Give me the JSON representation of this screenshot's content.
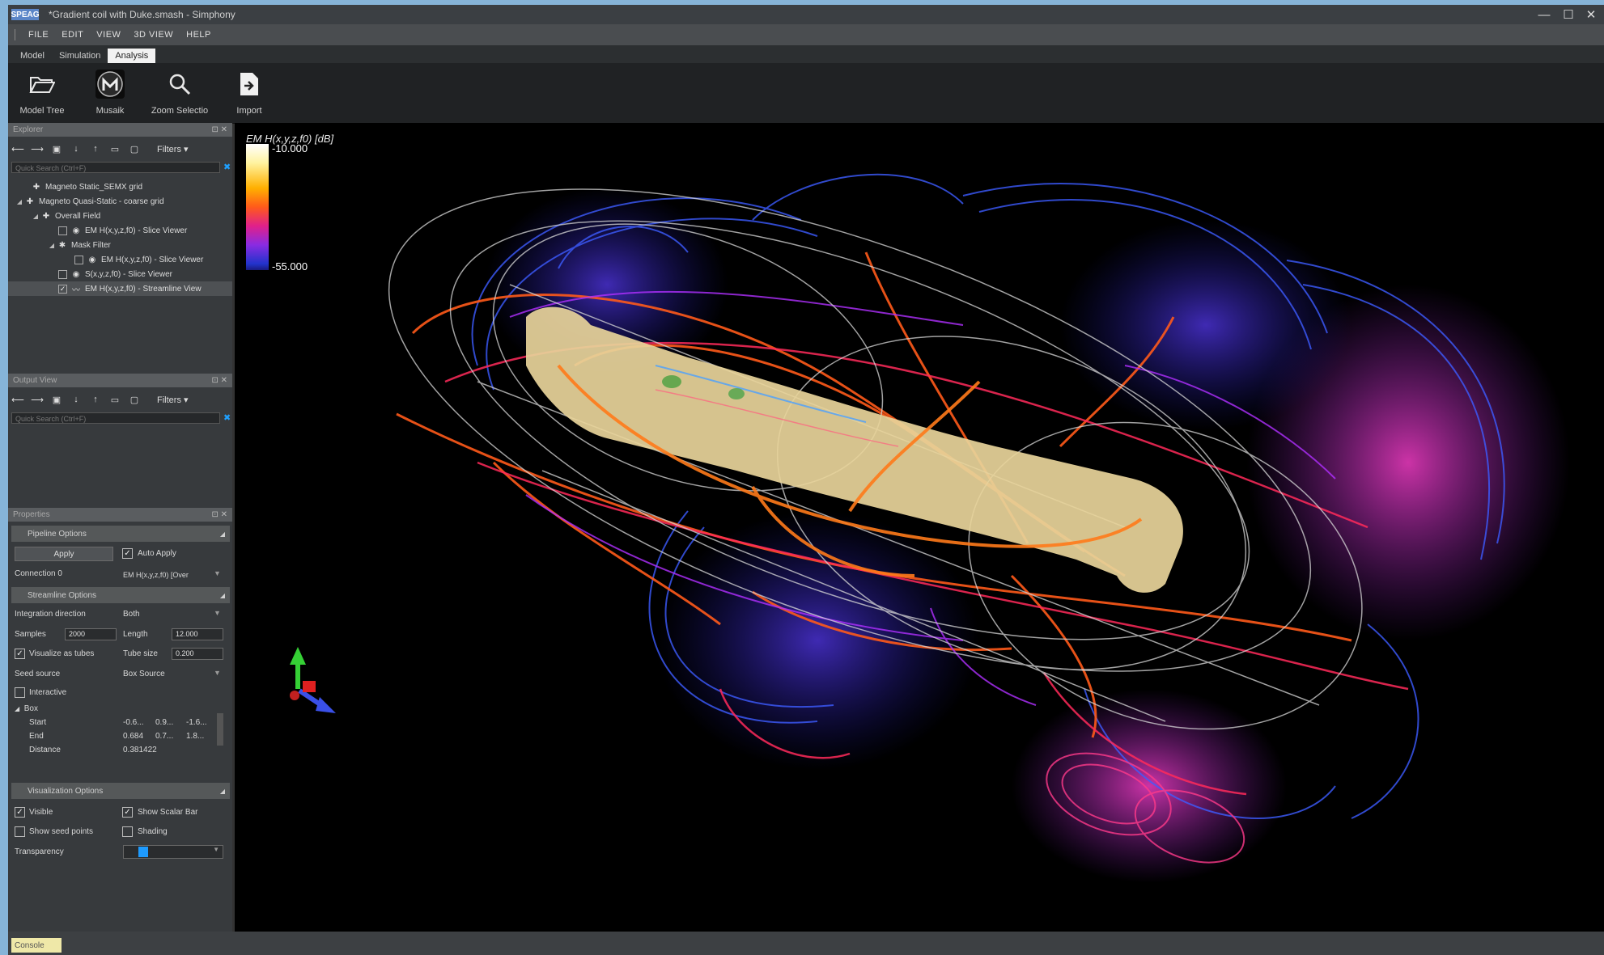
{
  "window": {
    "logo": "SPEAG",
    "title": "*Gradient coil with Duke.smash - Simphony",
    "controls": {
      "minimize": "—",
      "maximize": "☐",
      "close": "✕"
    }
  },
  "menu": [
    "FILE",
    "EDIT",
    "VIEW",
    "3D VIEW",
    "HELP"
  ],
  "ribbon_tabs": [
    "Model",
    "Simulation",
    "Analysis"
  ],
  "ribbon_buttons": [
    {
      "label": "Model Tree",
      "icon": "folder-icon"
    },
    {
      "label": "Musaik",
      "icon": "musaik-icon"
    },
    {
      "label": "Zoom Selectio",
      "icon": "zoom-selection-icon"
    },
    {
      "label": "Import",
      "icon": "import-icon"
    }
  ],
  "explorer": {
    "title": "Explorer",
    "filters_label": "Filters",
    "search_placeholder": "Quick Search (Ctrl+F)",
    "tree": [
      {
        "label": "Magneto Static_SEMX grid"
      },
      {
        "label": "Magneto Quasi-Static - coarse grid"
      },
      {
        "label": "Overall Field"
      },
      {
        "label": "EM H(x,y,z,f0) - Slice Viewer",
        "checked": false
      },
      {
        "label": "Mask Filter"
      },
      {
        "label": "EM H(x,y,z,f0) - Slice Viewer",
        "checked": false
      },
      {
        "label": "S(x,y,z,f0) - Slice Viewer",
        "checked": false
      },
      {
        "label": "EM H(x,y,z,f0) - Streamline View",
        "checked": true
      }
    ]
  },
  "output": {
    "title": "Output View",
    "filters_label": "Filters",
    "search_placeholder": "Quick Search (Ctrl+F)"
  },
  "properties": {
    "title": "Properties",
    "pipeline": {
      "section": "Pipeline Options",
      "apply": "Apply",
      "auto_apply": "Auto Apply",
      "auto_apply_checked": true,
      "connection_label": "Connection 0",
      "connection_value": "EM H(x,y,z,f0) [Over"
    },
    "streamline": {
      "section": "Streamline Options",
      "integration_label": "Integration direction",
      "integration_value": "Both",
      "samples_label": "Samples",
      "samples_value": "2000",
      "length_label": "Length",
      "length_value": "12.000",
      "tubes_label": "Visualize as tubes",
      "tubes_checked": true,
      "tube_size_label": "Tube size",
      "tube_size_value": "0.200",
      "seed_label": "Seed source",
      "seed_value": "Box Source",
      "interactive_label": "Interactive",
      "interactive_checked": false,
      "box_label": "Box",
      "start_label": "Start",
      "start_values": [
        "-0.6...",
        "0.9...",
        "-1.6..."
      ],
      "end_label": "End",
      "end_values": [
        "0.684",
        "0.7...",
        "1.8..."
      ],
      "distance_label": "Distance",
      "distance_value": "0.381422"
    },
    "visualization": {
      "section": "Visualization Options",
      "visible_label": "Visible",
      "visible_checked": true,
      "scalar_bar_label": "Show Scalar Bar",
      "scalar_bar_checked": true,
      "seed_points_label": "Show seed points",
      "seed_points_checked": false,
      "shading_label": "Shading",
      "shading_checked": false,
      "transparency_label": "Transparency"
    }
  },
  "viewport": {
    "scalar_bar_title": "EM H(x,y,z,f0) [dB]",
    "scalar_max": "-10.000",
    "scalar_min": "-55.000"
  },
  "status": {
    "console_label": "Console"
  },
  "colors": {
    "accent": "#1e9bff",
    "background": "#000000",
    "panel": "#373a3d"
  }
}
